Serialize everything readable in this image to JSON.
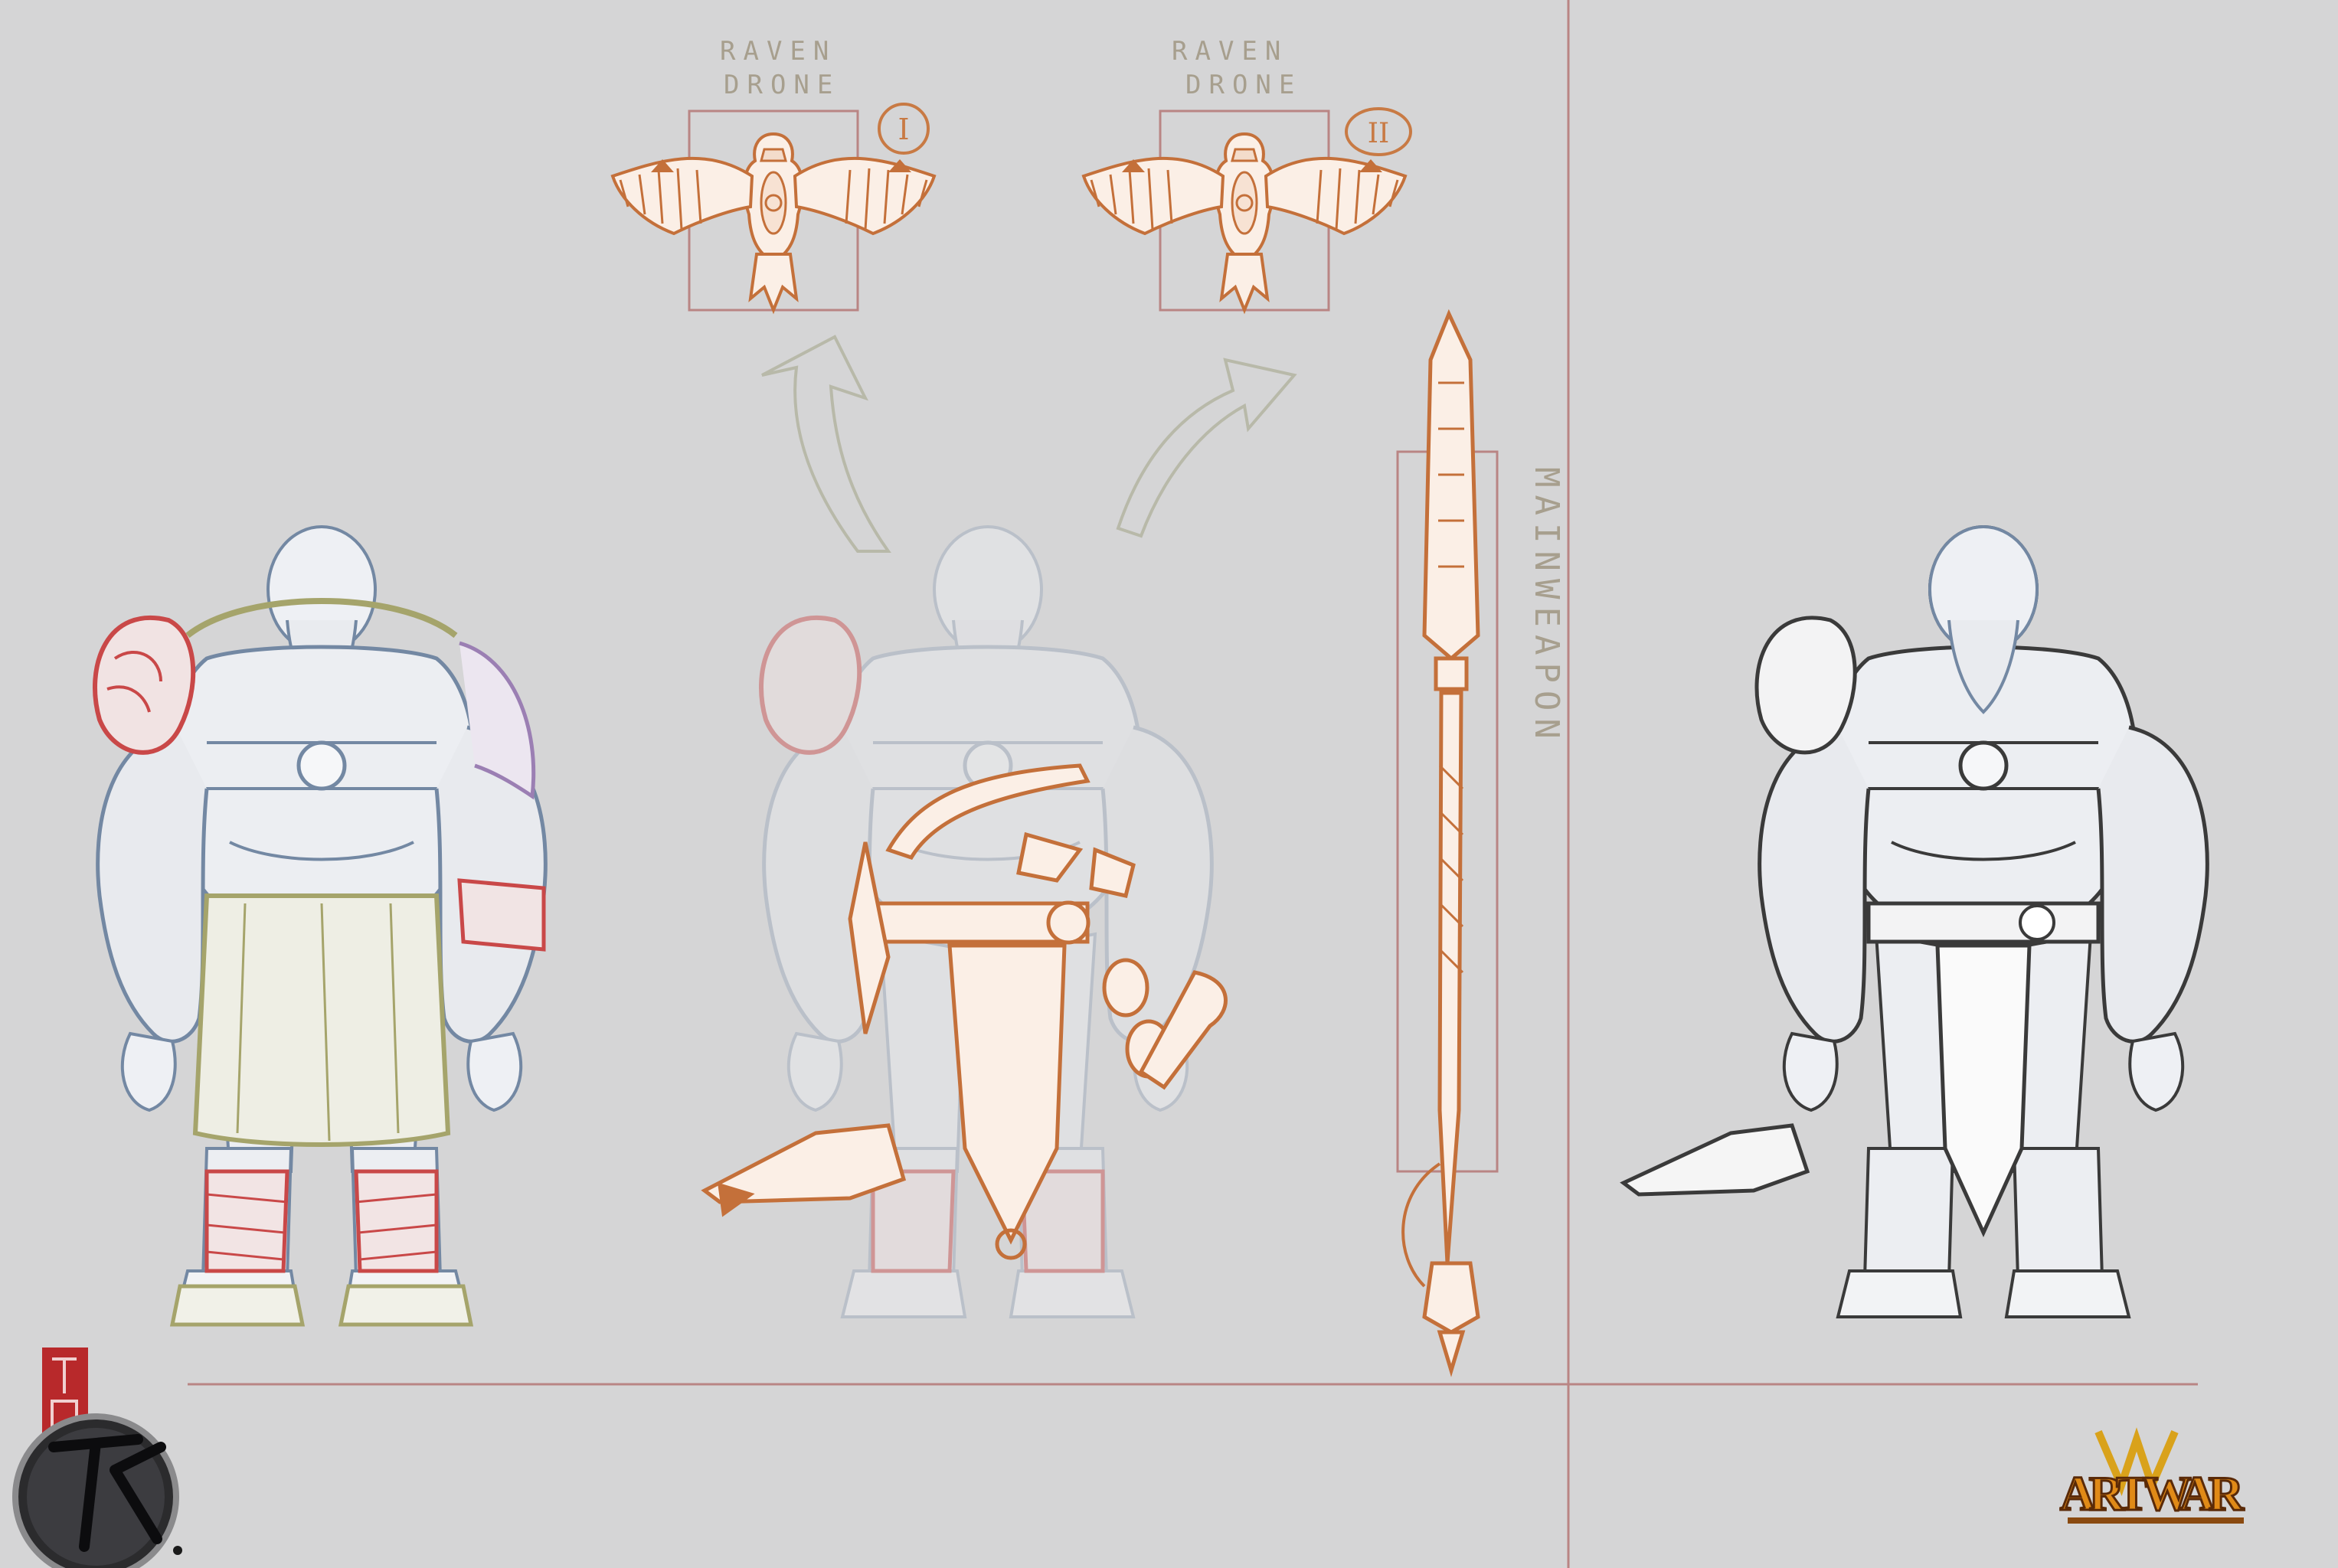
{
  "sheet": {
    "background": "#d5d5d6",
    "guide_line_color": "#b98584",
    "accent_orange": "#c4703a",
    "line_dark": "#3a3a3a",
    "line_blue": "#7388a3"
  },
  "drones": [
    {
      "label_line1": "RAVEN",
      "label_line2": "DRONE",
      "numeral": "I"
    },
    {
      "label_line1": "RAVEN",
      "label_line2": "DRONE",
      "numeral": "II"
    }
  ],
  "weapon": {
    "vertical_label": "MAINWEAPON"
  },
  "figures": [
    {
      "name": "color-coded-base-figure",
      "colors": [
        "#7388a3",
        "#a5a46b",
        "#c94848",
        "#9b7fb3"
      ]
    },
    {
      "name": "gear-overlay-figure",
      "colors": [
        "#c4703a"
      ]
    },
    {
      "name": "final-lineart-figure",
      "colors": [
        "#3a3a3a",
        "#7388a3"
      ]
    }
  ],
  "logos": {
    "artist_seal": "seal",
    "artist_monogram": "monogram",
    "brand": "ARTWAR"
  }
}
